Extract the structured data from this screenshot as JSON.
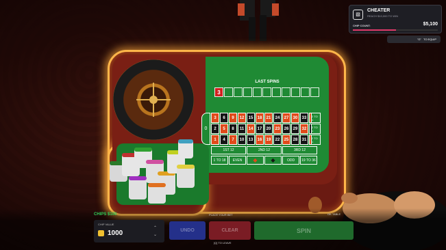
{
  "hud": {
    "title": "CHEATER",
    "subtitle": "REACH $10,000 TO WIN",
    "chip_count_label": "CHIP COUNT:",
    "chip_count_value": "$5,100",
    "progress_fraction": 0.51,
    "equip_key": "\"G\"",
    "equip_label": "TO EQUIP"
  },
  "table": {
    "last_spins_title": "LAST SPINS",
    "last_spins": [
      "3",
      "",
      "",
      "",
      "",
      "",
      "",
      "",
      "",
      "",
      ""
    ],
    "zero": "0",
    "numbers": [
      [
        "3",
        "6",
        "9",
        "12",
        "15",
        "18",
        "21",
        "24",
        "27",
        "30",
        "33",
        "36"
      ],
      [
        "2",
        "5",
        "8",
        "11",
        "14",
        "17",
        "20",
        "23",
        "26",
        "29",
        "32",
        "35"
      ],
      [
        "1",
        "4",
        "7",
        "10",
        "13",
        "16",
        "19",
        "22",
        "25",
        "28",
        "31",
        "34"
      ]
    ],
    "column_bets": [
      "2 TO 1",
      "2 TO 1",
      "2 TO 1"
    ],
    "dozens": [
      "1ST 12",
      "2ND 12",
      "3RD 12"
    ],
    "outside": [
      "1 TO 18",
      "EVEN",
      "◆",
      "◆",
      "ODD",
      "19 TO 36"
    ]
  },
  "bottom": {
    "chips_label": "CHIPS",
    "chips_value": "$100",
    "place_bet": "PLACE YOUR BET",
    "table_limit": "OK TABLE",
    "chip_value_label": "CHIP VALUE",
    "chip_value": "1000",
    "undo": "UNDO",
    "clear": "CLEAR",
    "spin": "SPIN",
    "leave_key": "[Q]",
    "leave_label": "TO LEAVE"
  },
  "colors": {
    "accent": "#ffb64a",
    "felt": "#1f8a34",
    "red": "#e04a1a",
    "black": "#151515"
  }
}
